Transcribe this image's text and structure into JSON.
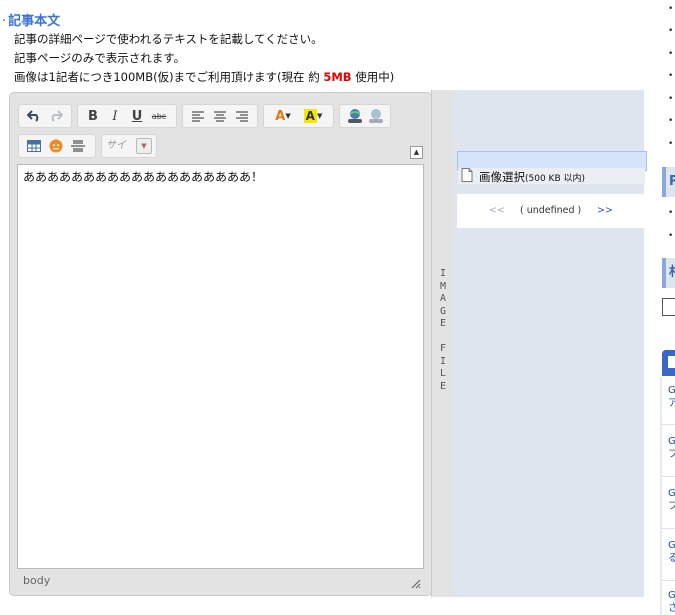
{
  "section": {
    "title": "記事本文",
    "desc_line1": "記事の詳細ページで使われるテキストを記載してください。",
    "desc_line2": "記事ページのみで表示されます。",
    "desc_line3_prefix": "画像は1記者につき100MB(仮)までご利用頂けます(現在 約 ",
    "desc_line3_amount": "5MB",
    "desc_line3_suffix": " 使用中)"
  },
  "editor": {
    "toolbar_icons": [
      "undo-icon",
      "redo-icon",
      "bold-icon",
      "italic-icon",
      "underline-icon",
      "strikethrough-icon",
      "align-left-icon",
      "align-center-icon",
      "align-right-icon",
      "text-color-icon",
      "background-color-icon",
      "link-icon",
      "unlink-icon",
      "table-icon",
      "emoticon-icon",
      "horizontal-rule-icon"
    ],
    "font_size_placeholder": "サイ",
    "content": "あああああああああああああああああああ！",
    "status_path": "body"
  },
  "image_panel": {
    "side_tab_label": [
      "I",
      "M",
      "A",
      "G",
      "E",
      " ",
      "F",
      "I",
      "L",
      "E"
    ],
    "select_label": "画像選択",
    "select_note": "(500 KB 以内)",
    "pager_prev": "<<",
    "pager_text": "( undefined )",
    "pager_next": ">>"
  },
  "right_sidebar": {
    "head1": "R",
    "head2": "村",
    "links": [
      "G",
      "ア",
      "G",
      "フ",
      "G",
      "フ",
      "G",
      "る",
      "G",
      "さ"
    ]
  },
  "colors": {
    "title_blue": "#3a72d6",
    "usage_red": "#ee0000",
    "panel_bg": "#dfe5ee",
    "link_blue": "#2a48b6"
  }
}
